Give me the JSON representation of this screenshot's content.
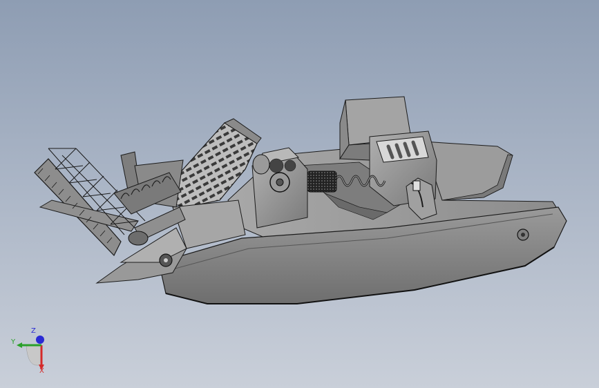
{
  "scene": {
    "background_top": "#8e9db3",
    "background_bottom": "#c9cfd9",
    "body_color": "#8a8a8a",
    "edge_color": "#1a1a1a"
  },
  "triad": {
    "x_label": "X",
    "y_label": "Y",
    "z_label": "Z",
    "x_color": "#d42a2a",
    "y_color": "#2aa02a",
    "z_color": "#2a2ad4"
  }
}
